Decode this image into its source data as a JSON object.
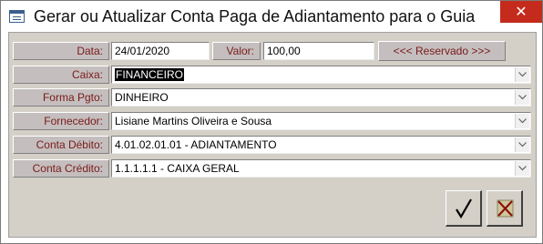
{
  "window": {
    "title": "Gerar ou Atualizar Conta Paga de Adiantamento para o Guia",
    "close_glyph": "✕"
  },
  "form": {
    "data": {
      "label": "Data:",
      "value": "24/01/2020"
    },
    "valor": {
      "label": "Valor:",
      "value": "100,00"
    },
    "reserved_button": "<<< Reservado >>>",
    "caixa": {
      "label": "Caixa:",
      "value": "FINANCEIRO"
    },
    "forma_pgto": {
      "label": "Forma Pgto:",
      "value": "DINHEIRO"
    },
    "fornecedor": {
      "label": "Fornecedor:",
      "value": "Lisiane Martins Oliveira e Sousa"
    },
    "conta_debito": {
      "label": "Conta Débito:",
      "value": "4.01.02.01.01 - ADIANTAMENTO"
    },
    "conta_credito": {
      "label": "Conta Crédito:",
      "value": "1.1.1.1.1 - CAIXA GERAL"
    }
  },
  "buttons": {
    "confirm_icon": "checkmark-icon",
    "cancel_icon": "cancel-x-icon"
  },
  "colors": {
    "label_bg": "#c4bebe",
    "label_text": "#7b1a1a",
    "form_bg": "#d4d0c8",
    "close_red": "#c42b1c"
  }
}
